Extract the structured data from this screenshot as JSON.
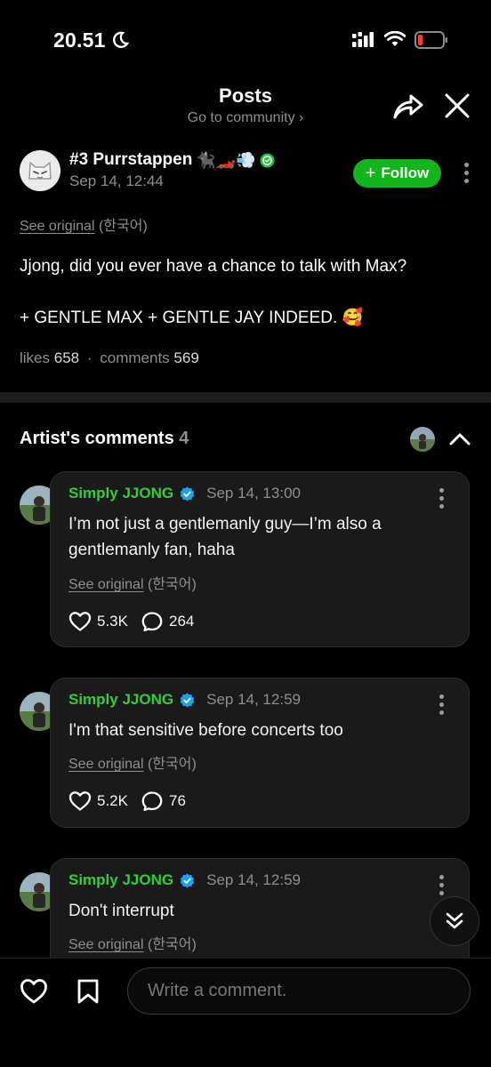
{
  "status_bar": {
    "time": "20.51"
  },
  "header": {
    "title": "Posts",
    "subtitle": "Go to community ›"
  },
  "post": {
    "author_name": "#3 Purrstappen",
    "author_emoji": "🐈‍⬛🏎️💨",
    "date": "Sep 14, 12:44",
    "follow_label": "Follow",
    "see_original": "See original",
    "original_lang": "(한국어)",
    "body_line1": "Jjong, did you ever have a chance to talk with Max?",
    "body_line2": "+ GENTLE MAX + GENTLE JAY INDEED. 🥰",
    "likes_label": "likes",
    "likes": "658",
    "comments_label": "comments",
    "comments": "569"
  },
  "artist_comments": {
    "title": "Artist's comments",
    "count": "4",
    "items": [
      {
        "name": "Simply JJONG",
        "date": "Sep 14, 13:00",
        "text": "I’m not just a gentlemanly guy—I’m also a gentlemanly fan, haha",
        "see_original": "See original",
        "lang": "(한국어)",
        "likes": "5.3K",
        "replies": "264"
      },
      {
        "name": "Simply JJONG",
        "date": "Sep 14, 12:59",
        "text": "I'm that sensitive before concerts too",
        "see_original": "See original",
        "lang": "(한국어)",
        "likes": "5.2K",
        "replies": "76"
      },
      {
        "name": "Simply JJONG",
        "date": "Sep 14, 12:59",
        "text": "Don't interrupt",
        "see_original": "See original",
        "lang": "(한국어)"
      }
    ]
  },
  "bottom_bar": {
    "comment_placeholder": "Write a comment."
  },
  "colors": {
    "accent_green": "#12b51c",
    "name_green": "#2fcf3a",
    "verified_blue": "#1da1f2",
    "background": "#000000"
  }
}
